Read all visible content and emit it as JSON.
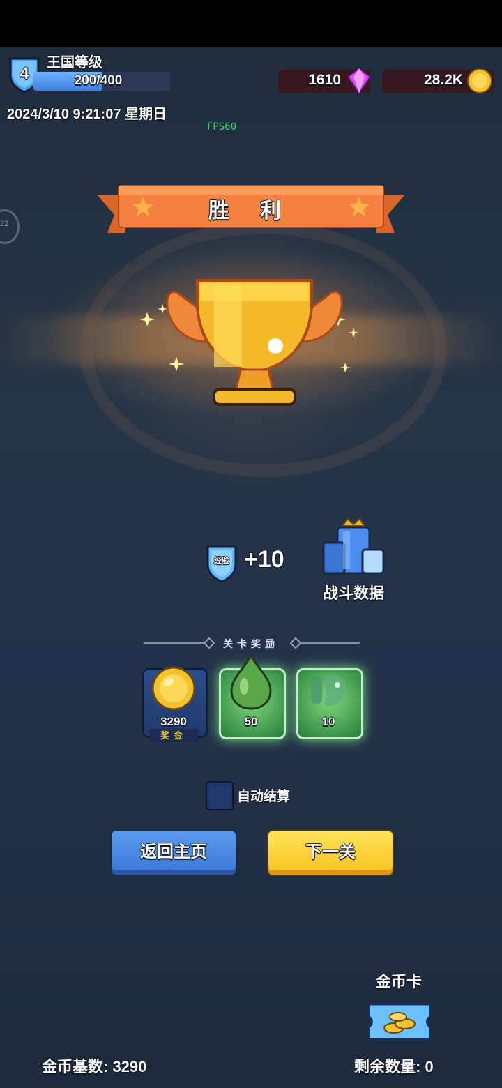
{
  "hud": {
    "level": "4",
    "kingdom_label": "王国等级",
    "xp_text": "200/400",
    "xp_progress": 0.5,
    "gems": "1610",
    "gold": "28.2K",
    "datetime": "2024/3/10 9:21:07 星期日",
    "fps": "FPS60",
    "side_badge_number": "22"
  },
  "result": {
    "title": "胜 利"
  },
  "rewards": {
    "xp_shield_label": "经验",
    "xp_gain": "+10",
    "battle_data_label": "战斗数据"
  },
  "level_rewards": {
    "section_title": "关卡奖励",
    "items": [
      {
        "icon": "gold-coin-icon",
        "value": "3290",
        "tag": "奖金"
      },
      {
        "icon": "green-drop-icon",
        "value": "50"
      },
      {
        "icon": "green-creature-icon",
        "value": "10"
      }
    ]
  },
  "controls": {
    "auto_settle_label": "自动结算",
    "home_button": "返回主页",
    "next_button": "下一关"
  },
  "footer": {
    "coin_card_label": "金币卡",
    "coin_base": "金币基数: 3290",
    "remaining": "剩余数量: 0"
  },
  "colors": {
    "banner": "#f07a3a",
    "button_blue": "#3b76d6",
    "button_yellow": "#f5c21e",
    "card_glow": "#8cff96"
  }
}
